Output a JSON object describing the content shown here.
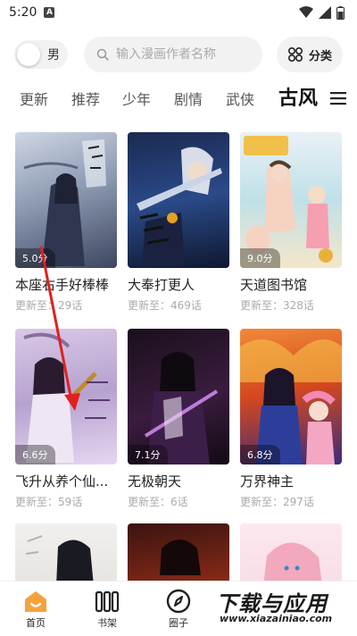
{
  "status": {
    "time": "5:20",
    "notif_letter": "A"
  },
  "top": {
    "gender_label": "男",
    "search_placeholder": "输入漫画作者名称",
    "category_label": "分类"
  },
  "tabs": [
    {
      "label": "更新"
    },
    {
      "label": "推荐"
    },
    {
      "label": "少年"
    },
    {
      "label": "剧情"
    },
    {
      "label": "武侠"
    },
    {
      "label": "古风"
    }
  ],
  "comics": [
    {
      "title": "本座右手好棒棒",
      "update": "更新至：29话",
      "score": "5.0分"
    },
    {
      "title": "大奉打更人",
      "update": "更新至：469话",
      "score": ""
    },
    {
      "title": "天道图书馆",
      "update": "更新至：328话",
      "score": "9.0分"
    },
    {
      "title": "飞升从养个仙...",
      "update": "更新至：59话",
      "score": "6.6分"
    },
    {
      "title": "无极朝天",
      "update": "更新至：6话",
      "score": "7.1分"
    },
    {
      "title": "万界神主",
      "update": "更新至：297话",
      "score": "6.8分"
    },
    {
      "title": "",
      "update": "",
      "score": ""
    },
    {
      "title": "",
      "update": "",
      "score": ""
    },
    {
      "title": "",
      "update": "",
      "score": ""
    }
  ],
  "nav": [
    {
      "label": "首页"
    },
    {
      "label": "书架"
    },
    {
      "label": "圈子"
    }
  ],
  "watermark": {
    "main": "下载与应用",
    "sub": "www.xiazainiao.com"
  },
  "colors": {
    "accent": "#f5a23c",
    "annotation": "#e02020"
  }
}
